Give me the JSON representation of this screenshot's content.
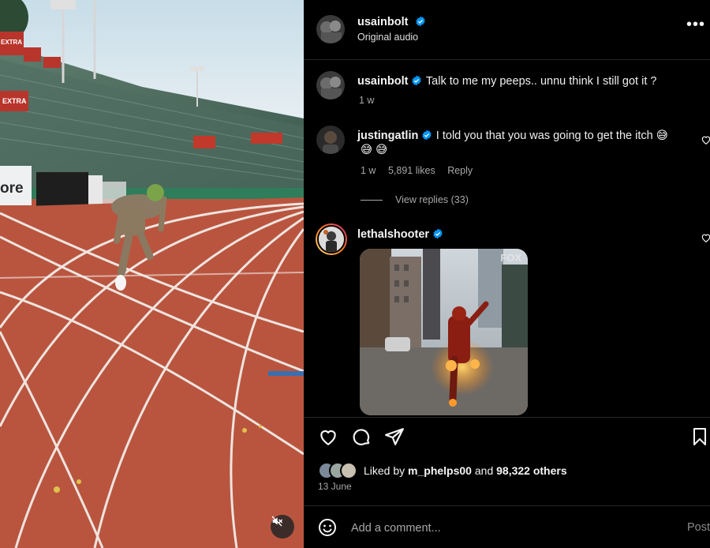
{
  "post": {
    "author": "usainbolt",
    "audio": "Original audio",
    "more_icon": "more-horizontal-icon"
  },
  "caption": {
    "author": "usainbolt",
    "text": "Talk to me my peeps.. unnu think I still got it ?",
    "time": "1 w"
  },
  "comments": [
    {
      "author": "justingatlin",
      "text": "I told you that you was going to get the itch 😅",
      "text_line2": "😅 😅",
      "time": "1 w",
      "likes": "5,891 likes",
      "reply_label": "Reply",
      "view_replies": "View replies (33)"
    },
    {
      "author": "lethalshooter",
      "gif_watermark": "FOX"
    }
  ],
  "actions": {
    "like_icon": "heart-outline-icon",
    "comment_icon": "comment-bubble-icon",
    "share_icon": "paper-plane-icon",
    "save_icon": "bookmark-icon"
  },
  "likes": {
    "prefix": "Liked by",
    "user": "m_phelps00",
    "connector": "and",
    "others": "98,322 others"
  },
  "date": "13 June",
  "composer": {
    "placeholder": "Add a comment...",
    "post_label": "Post"
  },
  "media": {
    "banner_text": "ore",
    "sign_text": "EXTRA"
  },
  "colors": {
    "verified": "#0095f6",
    "track": "#b9553f",
    "story_ring_start": "#feda75",
    "story_ring_end": "#d62976"
  }
}
